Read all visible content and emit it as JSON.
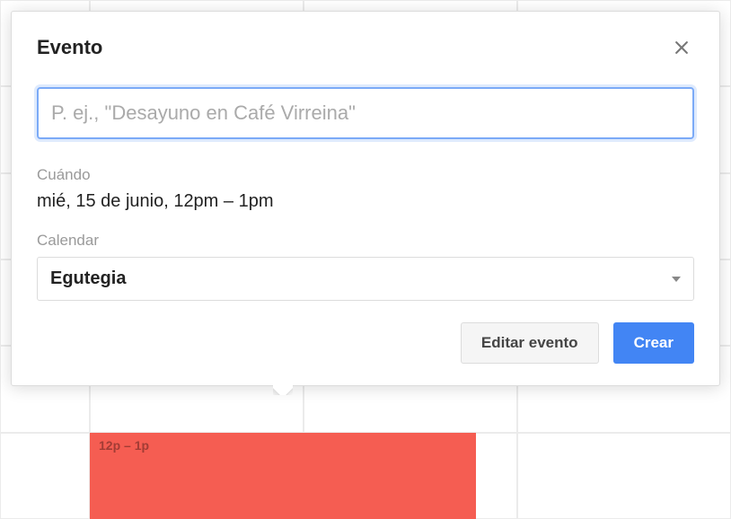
{
  "popover": {
    "title": "Evento",
    "title_input_placeholder": "P. ej., \"Desayuno en Café Virreina\"",
    "when_label": "Cuándo",
    "when_value": "mié, 15 de junio, 12pm – 1pm",
    "calendar_label": "Calendar",
    "calendar_selected": "Egutegia",
    "edit_button": "Editar evento",
    "create_button": "Crear"
  },
  "event_block": {
    "time_label": "12p – 1p"
  }
}
